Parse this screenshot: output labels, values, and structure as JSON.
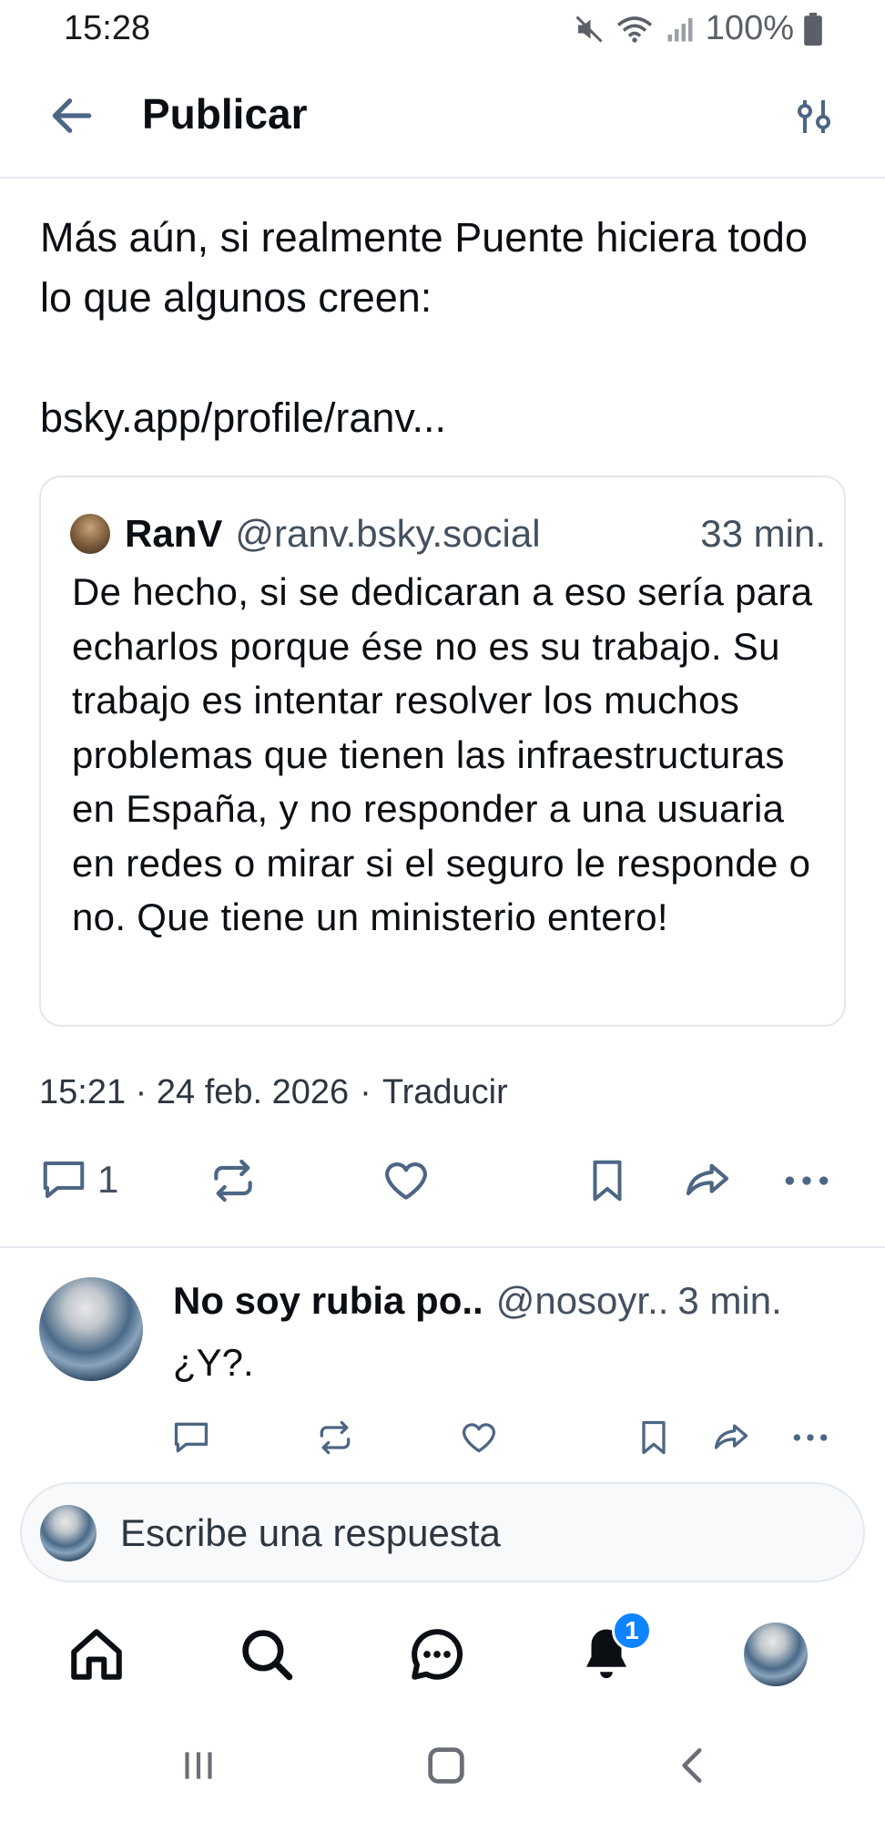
{
  "status_bar": {
    "time": "15:28",
    "battery": "100%",
    "icons": [
      "mute-icon",
      "wifi-icon",
      "signal-icon",
      "battery-icon"
    ]
  },
  "header": {
    "title": "Publicar",
    "back_icon": "arrow-left-icon",
    "settings_icon": "sliders-icon"
  },
  "post": {
    "text": "Más aún, si realmente Puente hiciera todo lo que algunos creen:\n\nbsky.app/profile/ranv...",
    "quote": {
      "name": "RanV",
      "handle": "@ranv.bsky.social",
      "time": "33 min.",
      "text": "De hecho, si se dedicaran a eso sería para echarlos porque ése no es su trabajo. Su trabajo es intentar resolver los muchos problemas que tienen las infraestructuras en España, y no responder a una usuaria en redes o mirar si el seguro le responde o no. Que tiene un ministerio entero!"
    },
    "timestamp": "15:21 · 24 feb. 2026",
    "separator": "·",
    "translate": "Traducir",
    "reply_count": "1"
  },
  "reply": {
    "name": "No soy rubia po..",
    "handle": "@nosoyr..",
    "time": "3 min.",
    "text": "¿Y?."
  },
  "compose": {
    "placeholder": "Escribe una respuesta"
  },
  "bottom_nav": {
    "items": [
      "home-icon",
      "search-icon",
      "chat-icon",
      "bell-icon",
      "profile-avatar"
    ],
    "notification_badge": "1"
  },
  "colors": {
    "icon_gray": "#5a6d82",
    "accent_blue": "#1083fe",
    "text": "#0b0f14",
    "muted": "#43505f"
  }
}
